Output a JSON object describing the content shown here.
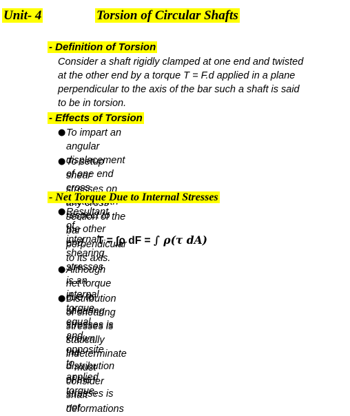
{
  "header": {
    "unit": "Unit- 4",
    "title": "Torsion of Circular Shafts"
  },
  "sections": {
    "definition": {
      "heading": "- Definition of Torsion",
      "lines": [
        "Consider a shaft rigidly clamped at one end and twisted",
        "at the other end by a torque T = F.d applied in a plane",
        "perpendicular to the axis of the bar such a shaft is said",
        "to be in torsion."
      ]
    },
    "effects": {
      "heading": "- Effects of Torsion",
      "bullets": [
        {
          "lines": [
            "To impart an angular displacement of one end cross",
            "section with respect to the other end."
          ]
        },
        {
          "lines": [
            "To setup shear stresses on any cross section of the",
            "bar perpendicular to its axis."
          ]
        }
      ]
    },
    "net_torque": {
      "heading": "- Net Torque Due to Internal Stresses",
      "bullets": [
        {
          "lines": [
            "Resultant of internal shearing stresses is an internal",
            "torque, equal and opposite to applied torque,"
          ]
        },
        {
          "lines": [
            "Although net torque due to shearing stresses is",
            "known, the distribution of the stresses is not"
          ]
        },
        {
          "lines": [
            "Distribution of shearing stresses is statically",
            "indeterminate – must consider shaft deformations"
          ]
        }
      ],
      "formula": {
        "lhs": "T = ",
        "part1": "∫ρ dF",
        "eq": " = ",
        "part2": "∫ ρ(τ dA)"
      }
    }
  },
  "bullet_glyph": "●"
}
